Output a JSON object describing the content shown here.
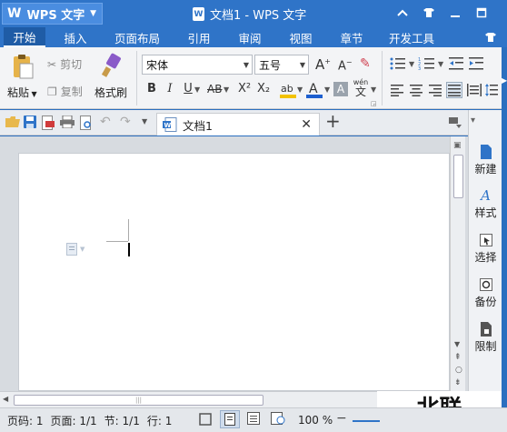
{
  "app": {
    "name": "WPS 文字",
    "logo": "W",
    "title": "文档1 - WPS 文字"
  },
  "menu": {
    "tabs": [
      "开始",
      "插入",
      "页面布局",
      "引用",
      "审阅",
      "视图",
      "章节",
      "开发工具"
    ],
    "active": "开始"
  },
  "ribbon": {
    "paste": "粘贴",
    "cut": "剪切",
    "copy": "复制",
    "format_painter": "格式刷",
    "font_name": "宋体",
    "font_size": "五号",
    "grow": "A",
    "shrink": "A",
    "bold": "B",
    "italic": "I",
    "underline": "U",
    "strike": "AB",
    "superscript": "X²",
    "subscript": "X₂",
    "pinyin_top": "wén",
    "pinyin_bottom": "文"
  },
  "qbar": {
    "doc_tab": "文档1"
  },
  "right_pane": {
    "items": [
      "新建",
      "样式",
      "选择",
      "备份",
      "限制"
    ]
  },
  "status": {
    "page": "页码: 1",
    "pages": "页面: 1/1",
    "section": "节: 1/1",
    "row": "行: 1",
    "zoom": "100 %"
  },
  "watermark": "北联",
  "colors": {
    "title_bar": "#2f74c8",
    "accent": "#2b6fbf",
    "ribbon_bg": "#f3f4f6",
    "highlight": "#f2c200",
    "font_color": "#1d5fcf"
  }
}
